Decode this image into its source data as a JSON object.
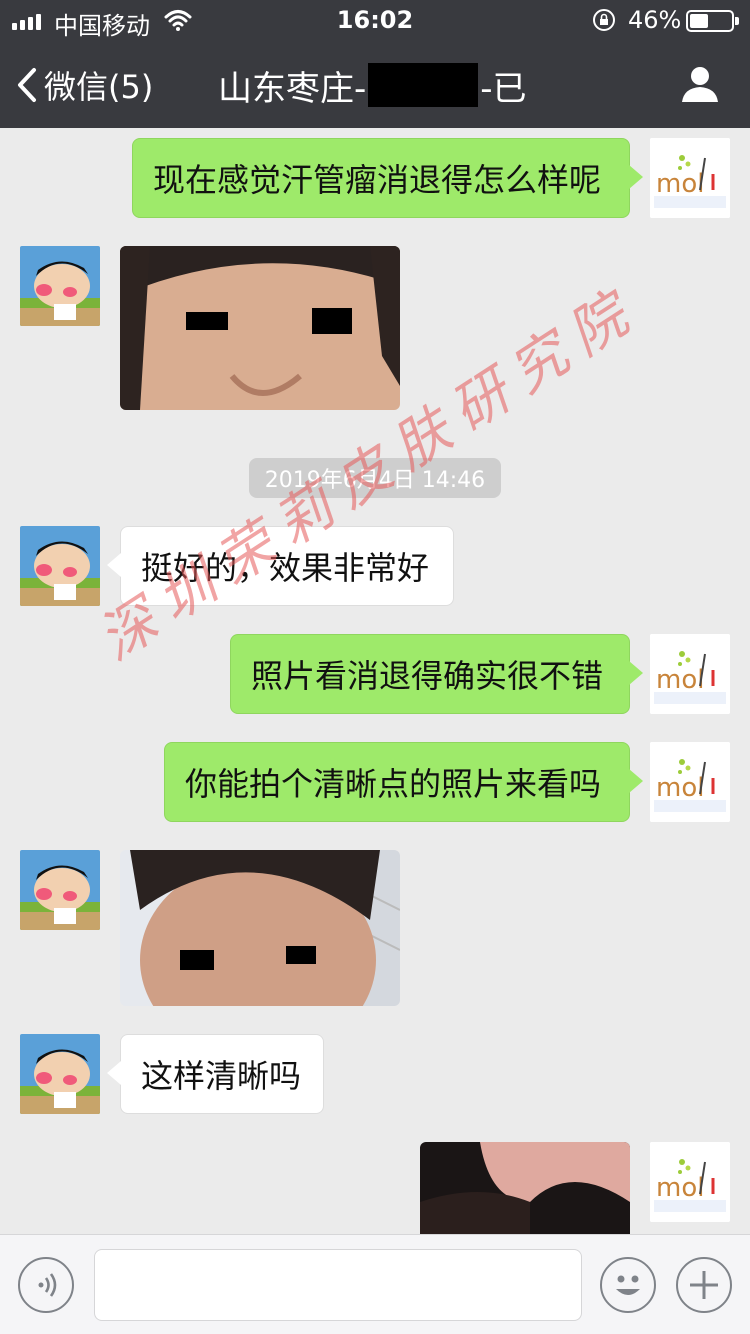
{
  "status_bar": {
    "carrier": "中国移动",
    "time": "16:02",
    "battery_percent": "46%",
    "battery_level": 0.46
  },
  "nav": {
    "back_label": "微信(5)",
    "title_prefix": "山东枣庄-",
    "title_suffix": "-已",
    "profile_icon": "person-icon"
  },
  "messages": [
    {
      "side": "me",
      "type": "text",
      "text": "现在感觉汗管瘤消退得怎么样呢"
    },
    {
      "side": "them",
      "type": "image",
      "alt": "face-photo-1"
    },
    {
      "type": "timestamp",
      "text": "2019年6月4日 14:46"
    },
    {
      "side": "them",
      "type": "text",
      "text": "挺好的，效果非常好"
    },
    {
      "side": "me",
      "type": "text",
      "text": "照片看消退得确实很不错"
    },
    {
      "side": "me",
      "type": "text",
      "text": "你能拍个清晰点的照片来看吗"
    },
    {
      "side": "them",
      "type": "image",
      "alt": "face-photo-2"
    },
    {
      "side": "them",
      "type": "text",
      "text": "这样清晰吗"
    },
    {
      "side": "me",
      "type": "image",
      "alt": "face-photo-3"
    }
  ],
  "my_avatar": {
    "logo_text": "mol"
  },
  "watermark": "深圳荣莉皮肤研究院",
  "input_bar": {
    "voice_icon": "voice-icon",
    "emoji_icon": "emoji-icon",
    "plus_icon": "plus-icon",
    "value": ""
  },
  "colors": {
    "nav_bg": "#393a3f",
    "chat_bg": "#ebebeb",
    "my_bubble": "#9eea6a",
    "their_bubble": "#ffffff"
  }
}
